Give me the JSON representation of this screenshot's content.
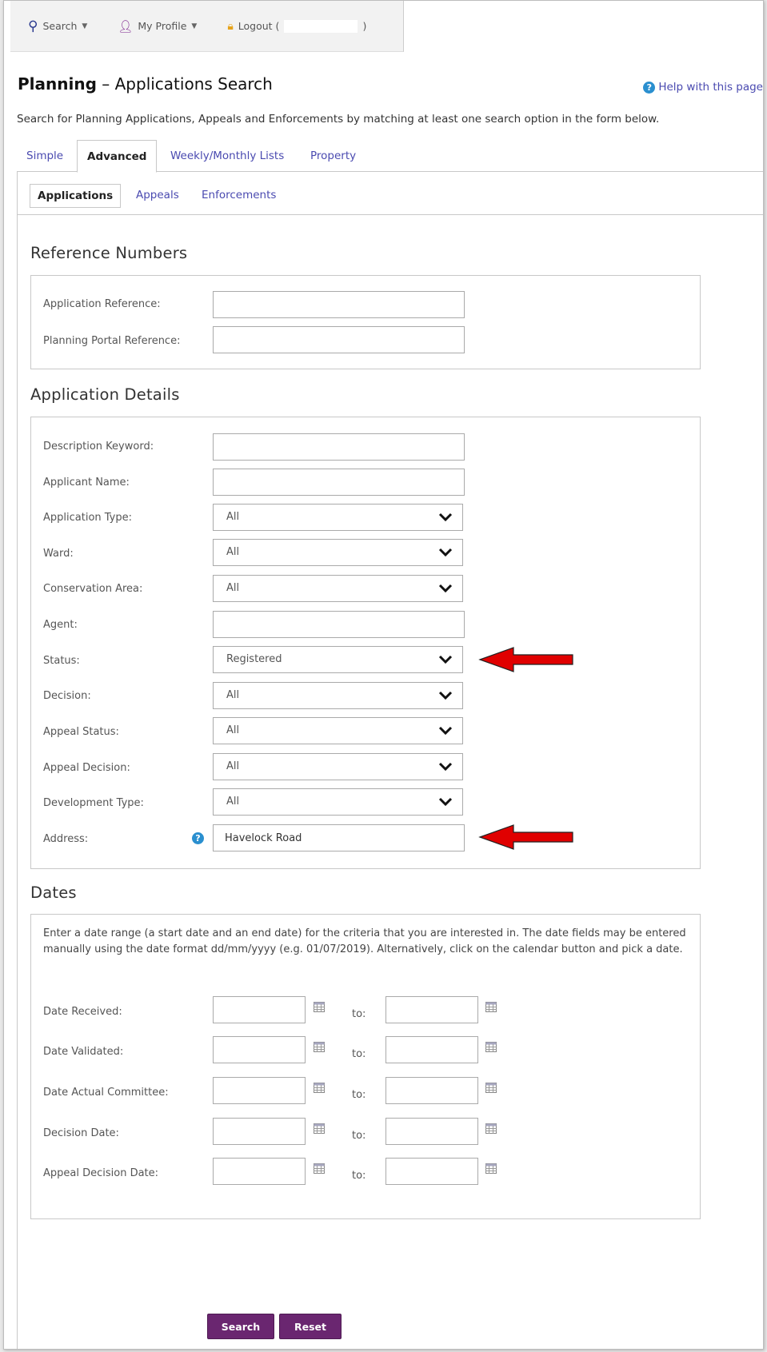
{
  "nav": {
    "search_label": "Search",
    "profile_label": "My Profile",
    "logout_label": "Logout (",
    "logout_close": ")"
  },
  "page": {
    "title_bold": "Planning",
    "title_rest": " – Applications Search",
    "help_label": "Help with this page",
    "intro": "Search for Planning Applications, Appeals and Enforcements by matching at least one search option in the form below."
  },
  "main_tabs": [
    "Simple",
    "Advanced",
    "Weekly/Monthly Lists",
    "Property"
  ],
  "sub_tabs": [
    "Applications",
    "Appeals",
    "Enforcements"
  ],
  "reference": {
    "title": "Reference Numbers",
    "application_reference_label": "Application Reference:",
    "application_reference_value": "",
    "portal_reference_label": "Planning Portal Reference:",
    "portal_reference_value": ""
  },
  "details": {
    "title": "Application Details",
    "description_label": "Description Keyword:",
    "description_value": "",
    "applicant_label": "Applicant Name:",
    "applicant_value": "",
    "app_type_label": "Application Type:",
    "app_type_value": "All",
    "ward_label": "Ward:",
    "ward_value": "All",
    "conservation_label": "Conservation Area:",
    "conservation_value": "All",
    "agent_label": "Agent:",
    "agent_value": "",
    "status_label": "Status:",
    "status_value": "Registered",
    "decision_label": "Decision:",
    "decision_value": "All",
    "appeal_status_label": "Appeal Status:",
    "appeal_status_value": "All",
    "appeal_decision_label": "Appeal Decision:",
    "appeal_decision_value": "All",
    "dev_type_label": "Development Type:",
    "dev_type_value": "All",
    "address_label": "Address:",
    "address_value": "Havelock Road"
  },
  "dates": {
    "title": "Dates",
    "description": "Enter a date range (a start date and an end date) for the criteria that you are interested in. The date fields may be entered manually using the date format dd/mm/yyyy (e.g. 01/07/2019). Alternatively, click on the calendar button and pick a date.",
    "to_label": "to:",
    "received_label": "Date Received:",
    "validated_label": "Date Validated:",
    "committee_label": "Date Actual Committee:",
    "decision_date_label": "Decision Date:",
    "appeal_decision_date_label": "Appeal Decision Date:"
  },
  "buttons": {
    "search": "Search",
    "reset": "Reset"
  },
  "colors": {
    "link": "#4a4ab0",
    "button": "#6a2670",
    "annotation_arrow": "#e00000",
    "help": "#2a8fcf"
  },
  "icons": [
    "search-icon",
    "user-icon",
    "lock-icon",
    "help-icon",
    "chevron-down-icon",
    "calendar-icon",
    "red-arrow-annotation"
  ]
}
